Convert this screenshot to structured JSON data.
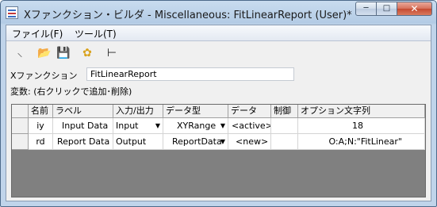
{
  "window": {
    "title": "Xファンクション・ビルダ - Miscellaneous: FitLinearReport (User)*",
    "min_glyph": "─",
    "max_glyph": "□",
    "close_glyph": "✕"
  },
  "menu": {
    "items": [
      "ファイル(F)",
      "ツール(T)"
    ]
  },
  "toolbar": {
    "icons": [
      {
        "name": "magic-wand-icon",
        "glyph": "⸜"
      },
      {
        "name": "open-folder-icon",
        "glyph": "📂"
      },
      {
        "name": "save-icon",
        "glyph": "💾"
      },
      {
        "name": "gear-icon",
        "glyph": "✿"
      },
      {
        "name": "tree-view-icon",
        "glyph": "⊢"
      }
    ]
  },
  "xfunction": {
    "label": "Xファンクション",
    "value": "FitLinearReport"
  },
  "variables_label": "変数: (右クリックで追加･削除)",
  "grid": {
    "headers": [
      "名前",
      "ラベル",
      "入力/出力",
      "データ型",
      "データ",
      "制御",
      "オプション文字列"
    ],
    "rows": [
      [
        "iy",
        "Input Data",
        "Input",
        "XYRange",
        "<active>",
        "",
        "18"
      ],
      [
        "rd",
        "Report Data",
        "Output",
        "ReportData",
        "<new>",
        "",
        "O:A;N:\"FitLinear\""
      ]
    ]
  }
}
